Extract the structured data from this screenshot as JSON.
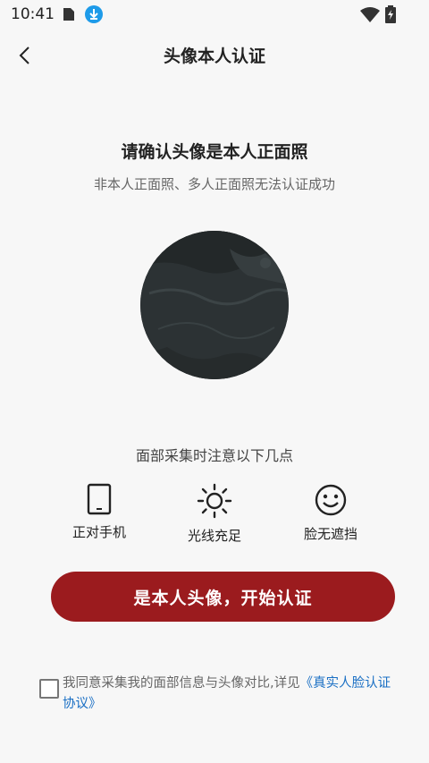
{
  "status_bar": {
    "time": "10:41"
  },
  "header": {
    "title": "头像本人认证",
    "back_icon": "chevron-left-icon"
  },
  "confirm": {
    "title": "请确认头像是本人正面照",
    "subtitle": "非本人正面照、多人正面照无法认证成功"
  },
  "tips": {
    "title": "面部采集时注意以下几点",
    "items": [
      {
        "label": "正对手机",
        "icon": "phone-icon"
      },
      {
        "label": "光线充足",
        "icon": "sun-icon"
      },
      {
        "label": "脸无遮挡",
        "icon": "smiley-icon"
      }
    ]
  },
  "primary_button": {
    "label": "是本人头像，开始认证",
    "color": "#9b1b1e"
  },
  "agreement": {
    "checked": false,
    "text": "我同意采集我的面部信息与头像对比,详见",
    "link": "《真实人脸认证协议》",
    "link_color": "#1a6fc4"
  }
}
